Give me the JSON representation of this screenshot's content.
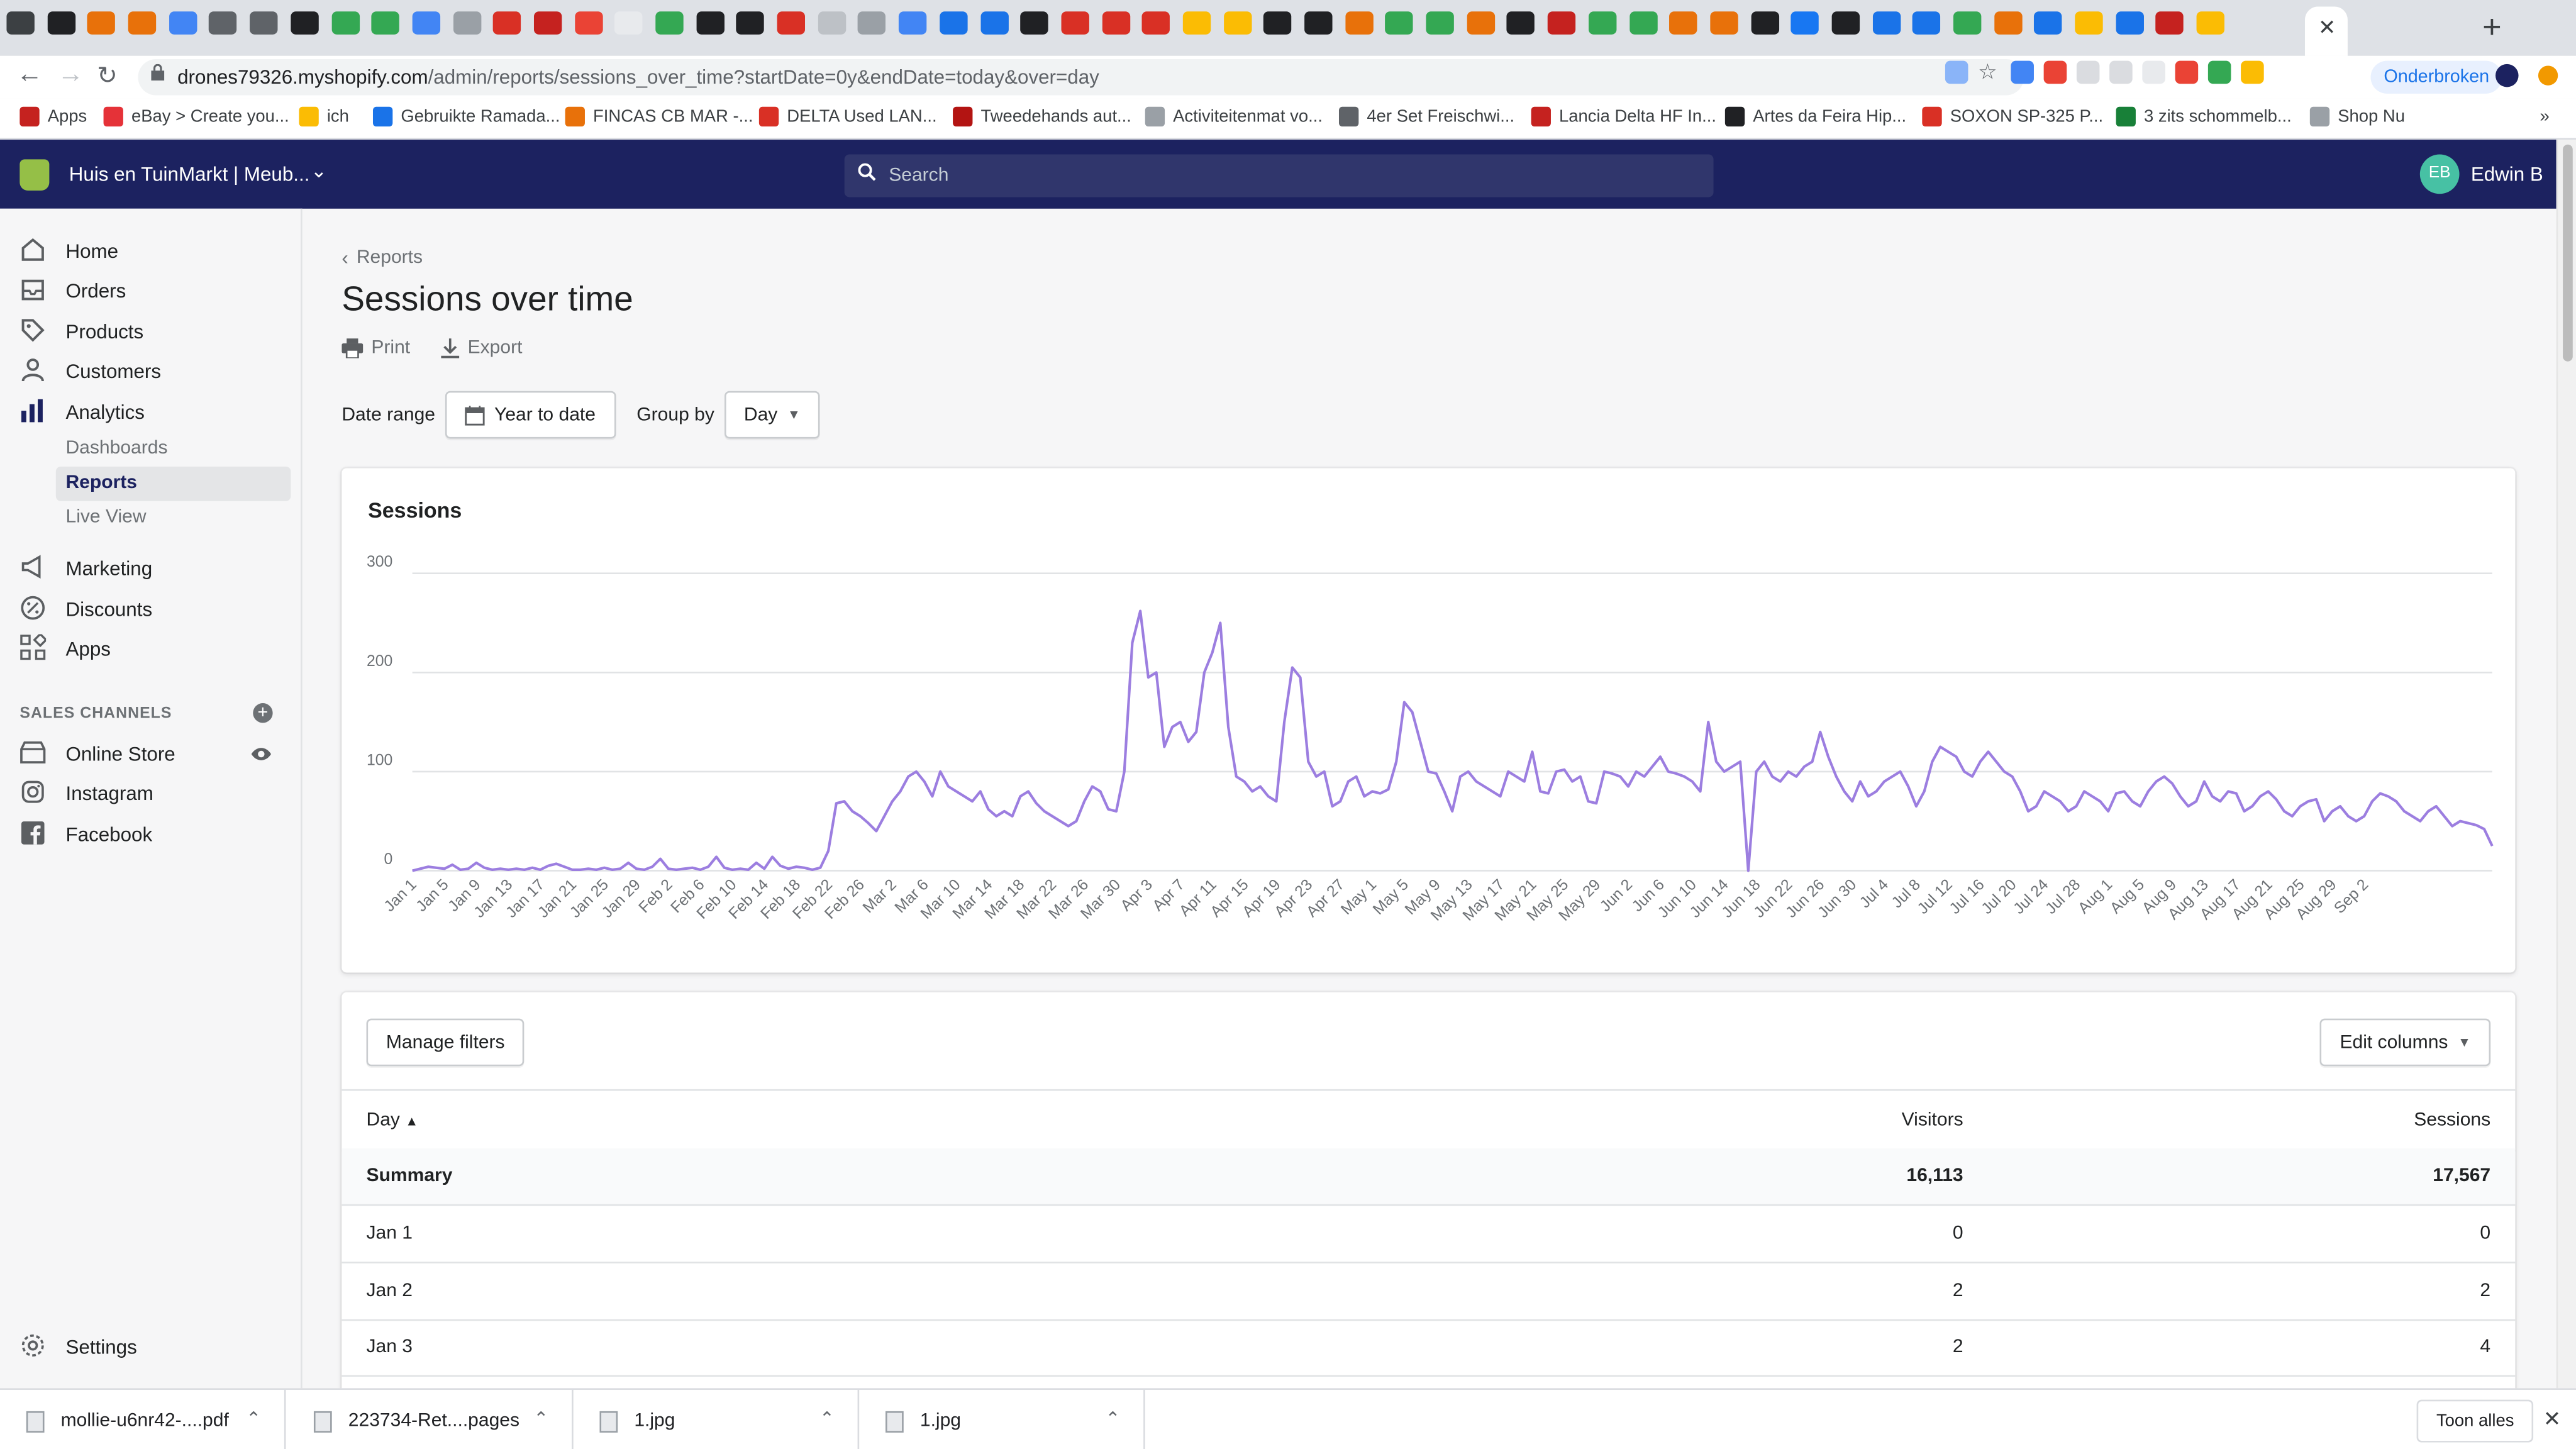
{
  "browser": {
    "url_host": "drones79326.myshopify.com",
    "url_path": "/admin/reports/sessions_over_time?startDate=0y&endDate=today&over=day",
    "profile_label": "Onderbroken",
    "bookmarks": [
      {
        "label": "Apps",
        "color": "#c5221f"
      },
      {
        "label": "eBay > Create you...",
        "color": "#e53238"
      },
      {
        "label": "ich",
        "color": "#fbbc04"
      },
      {
        "label": "Gebruikte Ramada...",
        "color": "#1a73e8"
      },
      {
        "label": "FINCAS CB MAR -...",
        "color": "#e8710a"
      },
      {
        "label": "DELTA Used LAN...",
        "color": "#d93025"
      },
      {
        "label": "Tweedehands aut...",
        "color": "#b31412"
      },
      {
        "label": "Activiteitenmat vo...",
        "color": "#9aa0a6"
      },
      {
        "label": "4er Set Freischwi...",
        "color": "#5f6368"
      },
      {
        "label": "Lancia Delta HF In...",
        "color": "#c5221f"
      },
      {
        "label": "Artes da Feira Hip...",
        "color": "#202124"
      },
      {
        "label": "SOXON SP-325 P...",
        "color": "#d93025"
      },
      {
        "label": "3 zits schommelb...",
        "color": "#188038"
      },
      {
        "label": "Shop Nu",
        "color": "#9aa0a6"
      }
    ]
  },
  "topbar": {
    "store_name": "Huis en TuinMarkt | Meub...",
    "search_placeholder": "Search",
    "avatar_initials": "EB",
    "user_name": "Edwin B"
  },
  "sidebar": {
    "items": [
      {
        "label": "Home"
      },
      {
        "label": "Orders"
      },
      {
        "label": "Products"
      },
      {
        "label": "Customers"
      },
      {
        "label": "Analytics"
      }
    ],
    "analytics_sub": [
      {
        "label": "Dashboards"
      },
      {
        "label": "Reports"
      },
      {
        "label": "Live View"
      }
    ],
    "items2": [
      {
        "label": "Marketing"
      },
      {
        "label": "Discounts"
      },
      {
        "label": "Apps"
      }
    ],
    "channels_heading": "SALES CHANNELS",
    "channels": [
      {
        "label": "Online Store"
      },
      {
        "label": "Instagram"
      },
      {
        "label": "Facebook"
      }
    ],
    "settings": "Settings"
  },
  "page": {
    "breadcrumb": "Reports",
    "title": "Sessions over time",
    "print_label": "Print",
    "export_label": "Export",
    "date_range_label": "Date range",
    "date_range_value": "Year to date",
    "group_by_label": "Group by",
    "group_by_value": "Day"
  },
  "chart_data": {
    "type": "line",
    "title": "Sessions",
    "ylim": [
      0,
      300
    ],
    "yticks": [
      0,
      100,
      200,
      300
    ],
    "grid": true,
    "line_color": "#9c7ee0",
    "x_tick_labels": [
      "Jan 1",
      "Jan 5",
      "Jan 9",
      "Jan 13",
      "Jan 17",
      "Jan 21",
      "Jan 25",
      "Jan 29",
      "Feb 2",
      "Feb 6",
      "Feb 10",
      "Feb 14",
      "Feb 18",
      "Feb 22",
      "Feb 26",
      "Mar 2",
      "Mar 6",
      "Mar 10",
      "Mar 14",
      "Mar 18",
      "Mar 22",
      "Mar 26",
      "Mar 30",
      "Apr 3",
      "Apr 7",
      "Apr 11",
      "Apr 15",
      "Apr 19",
      "Apr 23",
      "Apr 27",
      "May 1",
      "May 5",
      "May 9",
      "May 13",
      "May 17",
      "May 21",
      "May 25",
      "May 29",
      "Jun 2",
      "Jun 6",
      "Jun 10",
      "Jun 14",
      "Jun 18",
      "Jun 22",
      "Jun 26",
      "Jun 30",
      "Jul 4",
      "Jul 8",
      "Jul 12",
      "Jul 16",
      "Jul 20",
      "Jul 24",
      "Jul 28",
      "Aug 1",
      "Aug 5",
      "Aug 9",
      "Aug 13",
      "Aug 17",
      "Aug 21",
      "Aug 25",
      "Aug 29",
      "Sep 2"
    ],
    "series": [
      {
        "values": [
          0,
          2,
          4,
          3,
          2,
          6,
          1,
          2,
          8,
          3,
          1,
          2,
          1,
          2,
          1,
          3,
          1,
          5,
          7,
          4,
          1,
          1,
          2,
          1,
          3,
          1,
          2,
          8,
          2,
          1,
          4,
          12,
          2,
          1,
          2,
          3,
          1,
          4,
          14,
          3,
          1,
          2,
          1,
          8,
          2,
          14,
          5,
          2,
          4,
          3,
          1,
          3,
          20,
          68,
          70,
          60,
          55,
          48,
          40,
          55,
          70,
          80,
          95,
          100,
          90,
          75,
          100,
          85,
          80,
          75,
          70,
          80,
          62,
          55,
          60,
          55,
          75,
          80,
          68,
          60,
          55,
          50,
          45,
          50,
          70,
          85,
          80,
          62,
          60,
          100,
          230,
          262,
          195,
          200,
          125,
          145,
          150,
          130,
          140,
          200,
          220,
          250,
          145,
          95,
          90,
          80,
          85,
          75,
          70,
          150,
          205,
          195,
          110,
          95,
          100,
          65,
          70,
          90,
          95,
          75,
          80,
          78,
          82,
          110,
          170,
          160,
          130,
          100,
          98,
          80,
          60,
          95,
          100,
          90,
          85,
          80,
          75,
          100,
          95,
          90,
          120,
          80,
          78,
          100,
          102,
          90,
          95,
          70,
          68,
          100,
          98,
          95,
          85,
          100,
          95,
          105,
          115,
          100,
          98,
          95,
          90,
          80,
          150,
          110,
          100,
          105,
          110,
          0,
          100,
          110,
          95,
          90,
          100,
          95,
          105,
          110,
          140,
          115,
          95,
          80,
          70,
          90,
          75,
          80,
          90,
          95,
          100,
          85,
          65,
          80,
          110,
          125,
          120,
          115,
          100,
          95,
          110,
          120,
          110,
          100,
          95,
          80,
          60,
          65,
          80,
          75,
          70,
          60,
          65,
          80,
          75,
          70,
          60,
          78,
          80,
          70,
          65,
          80,
          90,
          95,
          88,
          75,
          65,
          70,
          90,
          75,
          70,
          80,
          78,
          60,
          65,
          75,
          80,
          72,
          60,
          55,
          65,
          70,
          72,
          50,
          60,
          65,
          55,
          50,
          55,
          70,
          78,
          75,
          70,
          60,
          55,
          50,
          60,
          65,
          55,
          45,
          50,
          48,
          46,
          42,
          25
        ]
      }
    ]
  },
  "table": {
    "manage_filters_label": "Manage filters",
    "edit_columns_label": "Edit columns",
    "columns": [
      "Day",
      "Visitors",
      "Sessions"
    ],
    "summary": {
      "label": "Summary",
      "visitors": "16,113",
      "sessions": "17,567"
    },
    "rows": [
      {
        "day": "Jan 1",
        "visitors": "0",
        "sessions": "0"
      },
      {
        "day": "Jan 2",
        "visitors": "2",
        "sessions": "2"
      },
      {
        "day": "Jan 3",
        "visitors": "2",
        "sessions": "4"
      }
    ]
  },
  "downloads": {
    "items": [
      {
        "name": "mollie-u6nr42-....pdf"
      },
      {
        "name": "223734-Ret....pages"
      },
      {
        "name": "1.jpg"
      },
      {
        "name": "1.jpg"
      }
    ],
    "show_all_label": "Toon alles"
  }
}
